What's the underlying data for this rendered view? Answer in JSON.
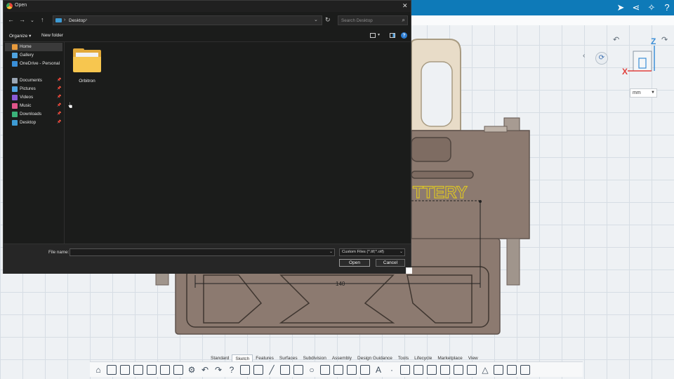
{
  "dialog": {
    "title": "Open",
    "path": "Desktop",
    "search_placeholder": "Search Desktop",
    "organize_label": "Organize",
    "new_folder_label": "New folder",
    "sidebar": [
      {
        "label": "Home",
        "icon": "home-icon",
        "color": "#e89a3c",
        "pinned": false
      },
      {
        "label": "Gallery",
        "icon": "gallery-icon",
        "color": "#4fa3e0",
        "pinned": false
      },
      {
        "label": "OneDrive - Personal",
        "icon": "cloud-icon",
        "color": "#3a8fd8",
        "pinned": false
      },
      {
        "label": "Documents",
        "icon": "documents-icon",
        "color": "#9aa6b5",
        "pinned": true
      },
      {
        "label": "Pictures",
        "icon": "pictures-icon",
        "color": "#4fa3e0",
        "pinned": true
      },
      {
        "label": "Videos",
        "icon": "videos-icon",
        "color": "#8a5bd6",
        "pinned": true
      },
      {
        "label": "Music",
        "icon": "music-icon",
        "color": "#e0558a",
        "pinned": true
      },
      {
        "label": "Downloads",
        "icon": "downloads-icon",
        "color": "#3ab37a",
        "pinned": true
      },
      {
        "label": "Desktop",
        "icon": "desktop-icon",
        "color": "#3d9bd4",
        "pinned": true
      }
    ],
    "files": [
      {
        "name": "Orbitron",
        "type": "folder"
      }
    ],
    "file_name_label": "File name:",
    "file_name_value": "",
    "filter_value": "Custom Files (*.ttf;*.otf)",
    "open_label": "Open",
    "cancel_label": "Cancel"
  },
  "cad": {
    "unit": "mm",
    "model_text": "TTERY",
    "dimension": "140",
    "axis_x": "X",
    "axis_z": "Z",
    "tabs": [
      "Standard",
      "Sketch",
      "Features",
      "Surfaces",
      "Subdivision",
      "Assembly",
      "Design Guidance",
      "Tools",
      "Lifecycle",
      "Marketplace",
      "View"
    ],
    "active_tab": "Sketch"
  }
}
